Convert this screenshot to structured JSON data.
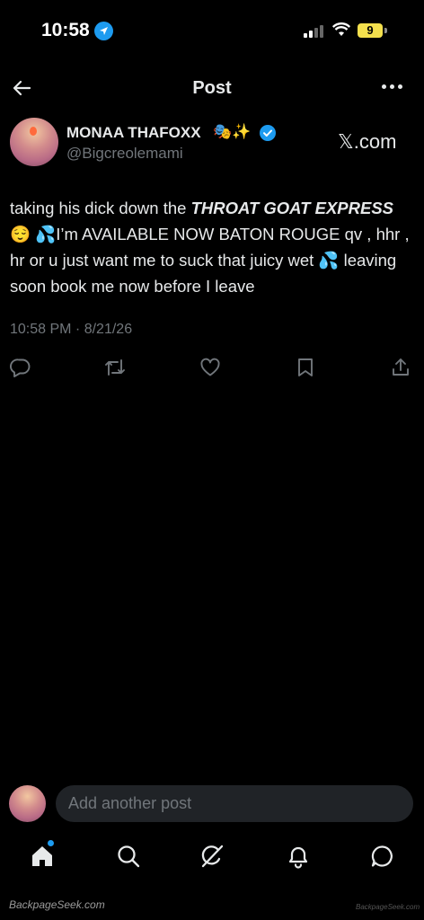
{
  "status_bar": {
    "time": "10:58",
    "battery": "9"
  },
  "header": {
    "title": "Post"
  },
  "author": {
    "name": "MONAA THAFOXX",
    "name_emoji": "🎭✨",
    "handle": "@Bigcreolemami"
  },
  "watermark_top": "𝕏.com",
  "post": {
    "text_part1": "taking his dick down the ",
    "text_bold": "THROAT GOAT EXPRESS",
    "text_part2": " 😌 💦I’m AVAILABLE NOW BATON ROUGE qv , hhr , hr or u just want me to suck that juicy wet 💦  leaving soon book me now before I leave",
    "timestamp": "10:58 PM · 8/21/26"
  },
  "reply": {
    "placeholder": "Add another post"
  },
  "icons": {
    "actions": [
      "reply-icon",
      "repost-icon",
      "like-icon",
      "bookmark-icon",
      "share-icon"
    ],
    "nav": [
      "home-icon",
      "search-icon",
      "grok-icon",
      "notifications-icon",
      "messages-icon"
    ]
  },
  "colors": {
    "accent": "#1d9bf0",
    "background": "#000000",
    "text": "#e7e9ea",
    "muted": "#71767b"
  },
  "watermarks": {
    "left": "BackpageSeek.com",
    "right": "BackpageSeek.com"
  }
}
